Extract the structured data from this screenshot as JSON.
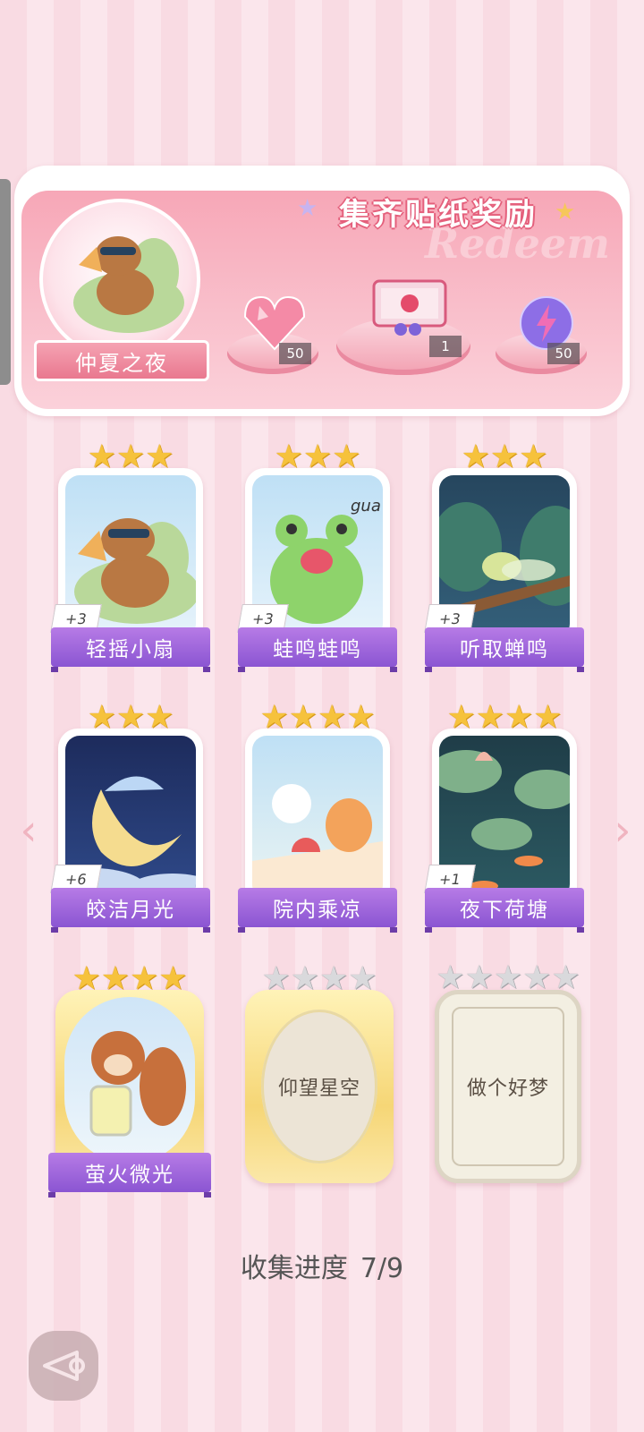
{
  "banner": {
    "title": "集齐贴纸奖励",
    "watermark": "Redeem",
    "theme_name": "仲夏之夜",
    "rewards": [
      {
        "icon": "pink-heart-gem-icon",
        "count": "50"
      },
      {
        "icon": "gift-box-icon",
        "count": "1"
      },
      {
        "icon": "lightning-orb-icon",
        "count": "50"
      }
    ]
  },
  "cards": [
    {
      "name": "轻摇小扇",
      "stars": 3,
      "bonus": "+3",
      "collected": true,
      "art": "capybara-fan"
    },
    {
      "name": "蛙鸣蛙鸣",
      "stars": 3,
      "bonus": "+3",
      "collected": true,
      "art": "frog",
      "art_text": "gua"
    },
    {
      "name": "听取蝉鸣",
      "stars": 3,
      "bonus": "+3",
      "collected": true,
      "art": "cicada"
    },
    {
      "name": "皎洁月光",
      "stars": 3,
      "bonus": "+6",
      "collected": true,
      "art": "moon"
    },
    {
      "name": "院内乘凉",
      "stars": 4,
      "bonus": "",
      "collected": true,
      "art": "cats-watermelon"
    },
    {
      "name": "夜下荷塘",
      "stars": 4,
      "bonus": "+1",
      "collected": true,
      "art": "lotus-pond"
    },
    {
      "name": "萤火微光",
      "stars": 4,
      "bonus": "",
      "collected": true,
      "art": "squirrel-firefly"
    },
    {
      "name": "仰望星空",
      "stars": 4,
      "bonus": "",
      "collected": false
    },
    {
      "name": "做个好梦",
      "stars": 5,
      "bonus": "",
      "collected": false
    }
  ],
  "progress": {
    "label": "收集进度",
    "value": "7/9"
  },
  "colors": {
    "accent": "#8b55d2",
    "star": "#f6c23c",
    "banner": "#f7a7b7"
  }
}
